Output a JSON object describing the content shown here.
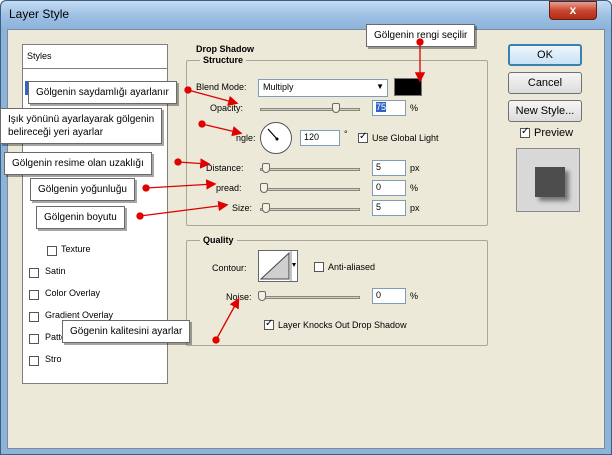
{
  "window": {
    "title": "Layer Style",
    "close_label": "x"
  },
  "styles_panel": {
    "header": "Styles",
    "items": [
      {
        "label": "Texture",
        "checked": false
      },
      {
        "label": "Satin",
        "checked": false
      },
      {
        "label": "Color Overlay",
        "checked": false
      },
      {
        "label": "Gradient Overlay",
        "checked": false
      },
      {
        "label": "Patte",
        "checked": false
      },
      {
        "label": "Stro",
        "checked": false
      }
    ]
  },
  "drop_shadow": {
    "title": "Drop Shadow",
    "structure_title": "Structure",
    "blend_mode_label": "Blend Mode:",
    "blend_mode_value": "Multiply",
    "swatch_color": "#000000",
    "opacity_label": "Opacity:",
    "opacity_value": "75",
    "opacity_unit": "%",
    "angle_label": "ngle:",
    "angle_value": "120",
    "angle_unit": "°",
    "use_global_light_label": "Use Global Light",
    "distance_label": "Distance:",
    "distance_value": "5",
    "distance_unit": "px",
    "spread_label": "pread:",
    "spread_value": "0",
    "spread_unit": "%",
    "size_label": "Size:",
    "size_value": "5",
    "size_unit": "px"
  },
  "quality": {
    "title": "Quality",
    "contour_label": "Contour:",
    "anti_aliased_label": "Anti-aliased",
    "noise_label": "Noise:",
    "noise_value": "0",
    "noise_unit": "%",
    "knocks_out_label": "Layer Knocks Out Drop Shadow"
  },
  "buttons": {
    "ok": "OK",
    "cancel": "Cancel",
    "new_style": "New Style...",
    "preview_label": "Preview"
  },
  "annotations": {
    "color": "Gölgenin rengi seçilir",
    "opacity": "Gölgenin saydamlığı ayarlanır",
    "angle_line1": "Işık yönünü ayarlayarak gölgenin",
    "angle_line2": "belireceği yeri ayarlar",
    "distance": "Gölgenin resime olan uzaklığı",
    "spread": "Gölgenin yoğunluğu",
    "size": "Gölgenin boyutu",
    "noise": "Gögenin kalitesini ayarlar"
  },
  "colors": {
    "arrow": "#e00000",
    "selection": "#3163c5"
  }
}
